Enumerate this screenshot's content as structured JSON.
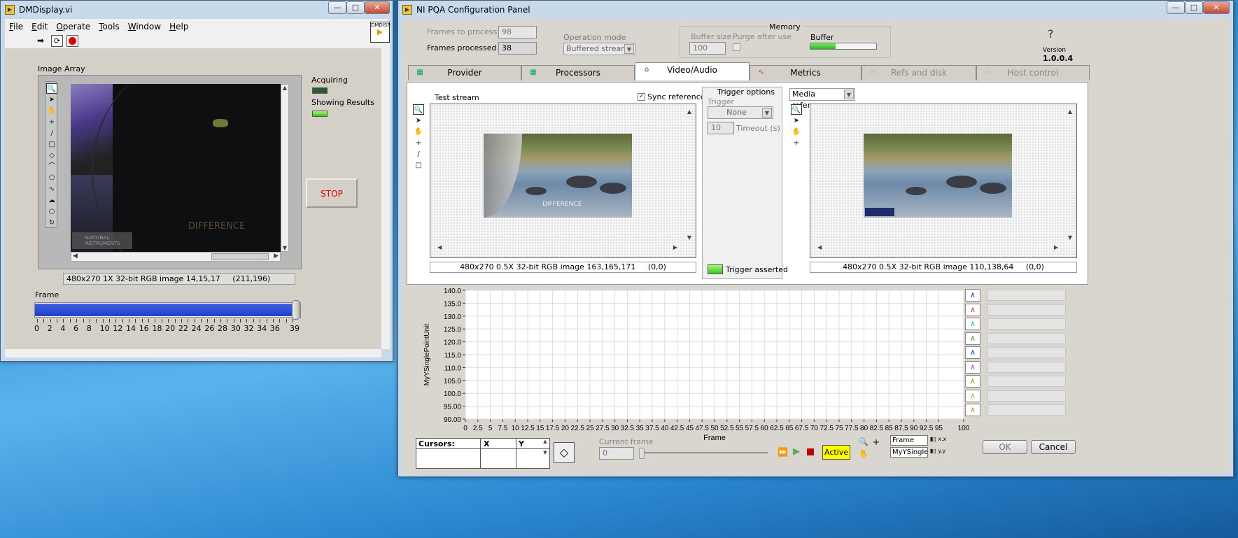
{
  "dm": {
    "title": "DMDisplay.vi",
    "controls": {
      "minimize": "—",
      "maximize": "□",
      "close": "✕"
    },
    "menu": [
      "File",
      "Edit",
      "Operate",
      "Tools",
      "Window",
      "Help"
    ],
    "vi_icon_label": "DMDISP",
    "image_array_label": "Image Array",
    "difference_text": "DIFFERENCE",
    "ni_logo_text": "NATIONAL INSTRUMENTS",
    "image_info": "480x270 1X 32-bit RGB image 14,15,17     (211,196)",
    "acquiring_label": "Acquiring",
    "showing_results_label": "Showing Results",
    "stop_label": "STOP",
    "frame_label": "Frame",
    "frame_ticks": [
      "0",
      "2",
      "4",
      "6",
      "8",
      "10",
      "12",
      "14",
      "16",
      "18",
      "20",
      "22",
      "24",
      "26",
      "28",
      "30",
      "32",
      "34",
      "36",
      "39"
    ],
    "frame_value": 39,
    "frame_max": 39
  },
  "pqa": {
    "title": "NI PQA Configuration Panel",
    "frames_to_process_label": "Frames to process",
    "frames_to_process_value": "98",
    "frames_processed_label": "Frames processed",
    "frames_processed_value": "38",
    "operation_mode_label": "Operation mode",
    "operation_mode_value": "Buffered stream",
    "memory_label": "Memory",
    "buffer_size_label": "Buffer size",
    "buffer_size_value": "100",
    "purge_label": "Purge after use",
    "buffer_label": "Buffer",
    "buffer_fill": 0.38,
    "help_icon": "?",
    "version_label": "Version",
    "version_value": "1.0.0.4",
    "tabs": [
      "Provider",
      "Processors",
      "Video/Audio",
      "Metrics",
      "Refs and disk",
      "Host control"
    ],
    "test_stream_label": "Test stream",
    "sync_reference_label": "Sync reference",
    "trigger_options_label": "Trigger options",
    "trigger_label": "Trigger",
    "trigger_value": "None",
    "timeout_value": "10",
    "timeout_label": "Timeout (s)",
    "trigger_asserted_label": "Trigger asserted",
    "media_reference_label": "Media reference",
    "test_image_info": "480x270 0.5X 32-bit RGB image 163,165,171     (0,0)",
    "ref_image_info": "480x270 0.5X 32-bit RGB image 110,138,64     (0,0)",
    "difference_text": "DIFFERENCE",
    "cursors_header": "Cursors:",
    "cursors_x": "X",
    "cursors_y": "Y",
    "current_frame_label": "Current frame",
    "current_frame_value": "0",
    "active_label": "Active",
    "frame_legend": "Frame",
    "y_legend": "MyYSingleP",
    "ok_label": "OK",
    "cancel_label": "Cancel"
  },
  "chart_data": {
    "type": "line",
    "title": "",
    "xlabel": "Frame",
    "ylabel": "MyYSinglePointUnit",
    "xlim": [
      0,
      100
    ],
    "ylim": [
      90,
      140
    ],
    "x_ticks": [
      "0",
      "2.5",
      "5",
      "7.5",
      "10",
      "12.5",
      "15",
      "17.5",
      "20",
      "22.5",
      "25",
      "27.5",
      "30",
      "32.5",
      "35",
      "37.5",
      "40",
      "42.5",
      "45",
      "47.5",
      "50",
      "52.5",
      "55",
      "57.5",
      "60",
      "62.5",
      "65",
      "67.5",
      "70",
      "72.5",
      "75",
      "77.5",
      "80",
      "82.5",
      "85",
      "87.5",
      "90",
      "92.5",
      "95",
      "100"
    ],
    "y_ticks": [
      "140.0",
      "135.0",
      "130.0",
      "125.0",
      "120.0",
      "115.0",
      "110.0",
      "105.0",
      "100.0",
      "95.00",
      "90.00"
    ],
    "grid": true,
    "series_colors": [
      "#1f3f8f",
      "#d43a3a",
      "#20b0c8",
      "#3a9a3a",
      "#1f3f8f",
      "#c040c0",
      "#70b020",
      "#c8a030",
      "#c87830"
    ]
  }
}
